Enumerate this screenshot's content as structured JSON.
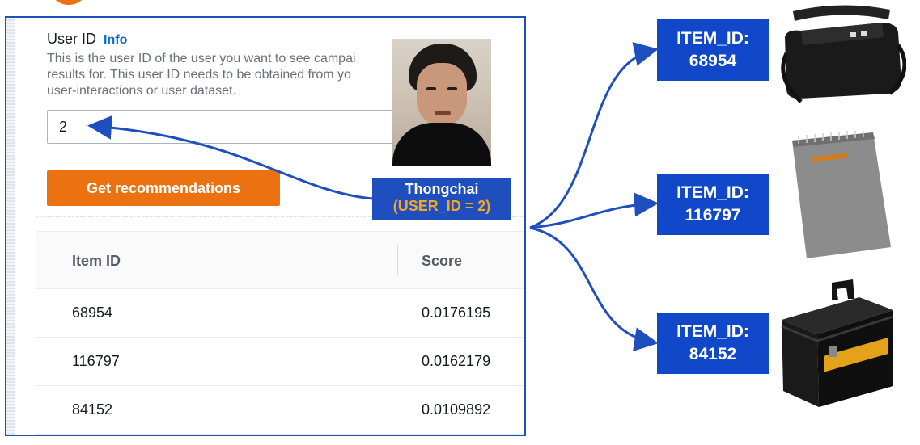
{
  "form": {
    "label": "User ID",
    "info_link": "Info",
    "description_lines": [
      "This is the user ID of the user you want to see campai",
      "results for. This user ID needs to be obtained from yo",
      "user-interactions or user dataset."
    ],
    "user_id_value": "2",
    "button_label": "Get recommendations"
  },
  "table": {
    "headers": [
      "Item ID",
      "Score"
    ],
    "rows": [
      {
        "item_id": "68954",
        "score": "0.0176195"
      },
      {
        "item_id": "116797",
        "score": "0.0162179"
      },
      {
        "item_id": "84152",
        "score": "0.0109892"
      }
    ]
  },
  "user_card": {
    "name": "Thongchai",
    "user_id_label": "(USER_ID = 2)"
  },
  "items": [
    {
      "label": "ITEM_ID:",
      "id": "68954",
      "icon": "duffel-bag-icon"
    },
    {
      "label": "ITEM_ID:",
      "id": "116797",
      "icon": "notebook-icon"
    },
    {
      "label": "ITEM_ID:",
      "id": "84152",
      "icon": "ammo-can-icon"
    }
  ],
  "colors": {
    "accent_orange": "#ec7211",
    "annotation_blue": "#1f4fbf",
    "link_blue": "#0b6bcb",
    "highlight_orange": "#f5a623"
  }
}
